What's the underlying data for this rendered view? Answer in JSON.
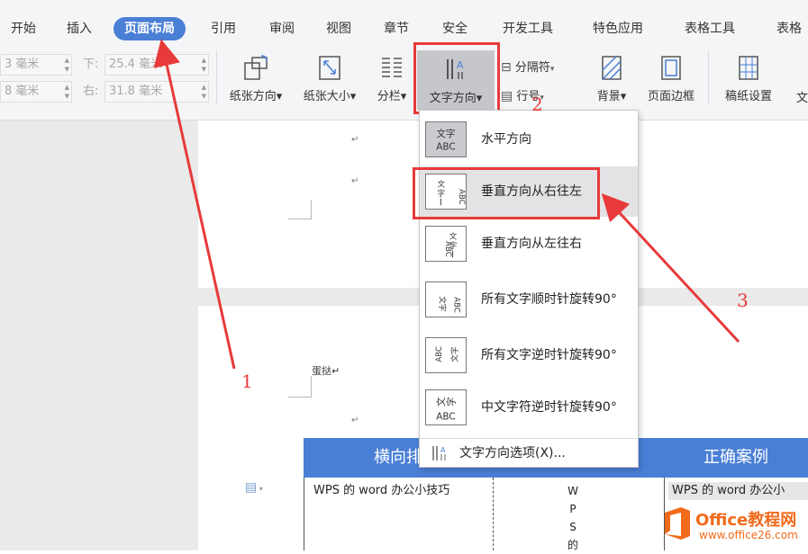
{
  "menu": {
    "tabs": [
      "开始",
      "插入",
      "页面布局",
      "引用",
      "审阅",
      "视图",
      "章节",
      "安全",
      "开发工具",
      "特色应用",
      "表格工具",
      "表格"
    ],
    "active_tab": "页面布局"
  },
  "ribbon": {
    "margin_top_partial": "毫米",
    "margin_top_partial_prefix": "3",
    "margin_bottom_label": "下:",
    "margin_bottom_value": "25.4 毫米",
    "margin_left_partial": "毫米",
    "margin_left_partial_prefix": "8",
    "margin_right_label": "右:",
    "margin_right_value": "31.8 毫米",
    "paper_orientation": "纸张方向",
    "paper_size": "纸张大小",
    "columns": "分栏",
    "text_direction": "文字方向",
    "separator": "分隔符",
    "line_numbers": "行号",
    "background": "背景",
    "page_border": "页面边框",
    "manuscript_settings": "稿纸设置",
    "cut_label": "文"
  },
  "dropdown": {
    "items": [
      {
        "label": "水平方向",
        "icon": "horizontal-text-icon"
      },
      {
        "label": "垂直方向从右往左",
        "icon": "vertical-rtl-text-icon"
      },
      {
        "label": "垂直方向从左往右",
        "icon": "vertical-ltr-text-icon"
      },
      {
        "label": "所有文字顺时针旋转90°",
        "icon": "rotate-cw-text-icon"
      },
      {
        "label": "所有文字逆时针旋转90°",
        "icon": "rotate-ccw-text-icon"
      },
      {
        "label": "中文字符逆时针旋转90°",
        "icon": "cjk-rotate-ccw-text-icon"
      }
    ],
    "options_label": "文字方向选项(X)..."
  },
  "document": {
    "paragraph_mark": "↵",
    "text_egg": "蛋挞",
    "table_headers": [
      "横向排",
      "正确案例"
    ],
    "cell_left": "WPS 的 word 办公小技巧",
    "cell_middle_letters": [
      "W",
      "P",
      "S",
      "的"
    ],
    "cell_right": "WPS 的 word 办公小"
  },
  "annotations": {
    "n1": "1",
    "n2": "2",
    "n3": "3"
  },
  "watermark": {
    "title": "Office教程网",
    "url": "www.office26.com"
  },
  "colors": {
    "accent": "#4a7fd6",
    "highlight": "#e83a3a",
    "watermark_orange": "#f26a1b"
  }
}
